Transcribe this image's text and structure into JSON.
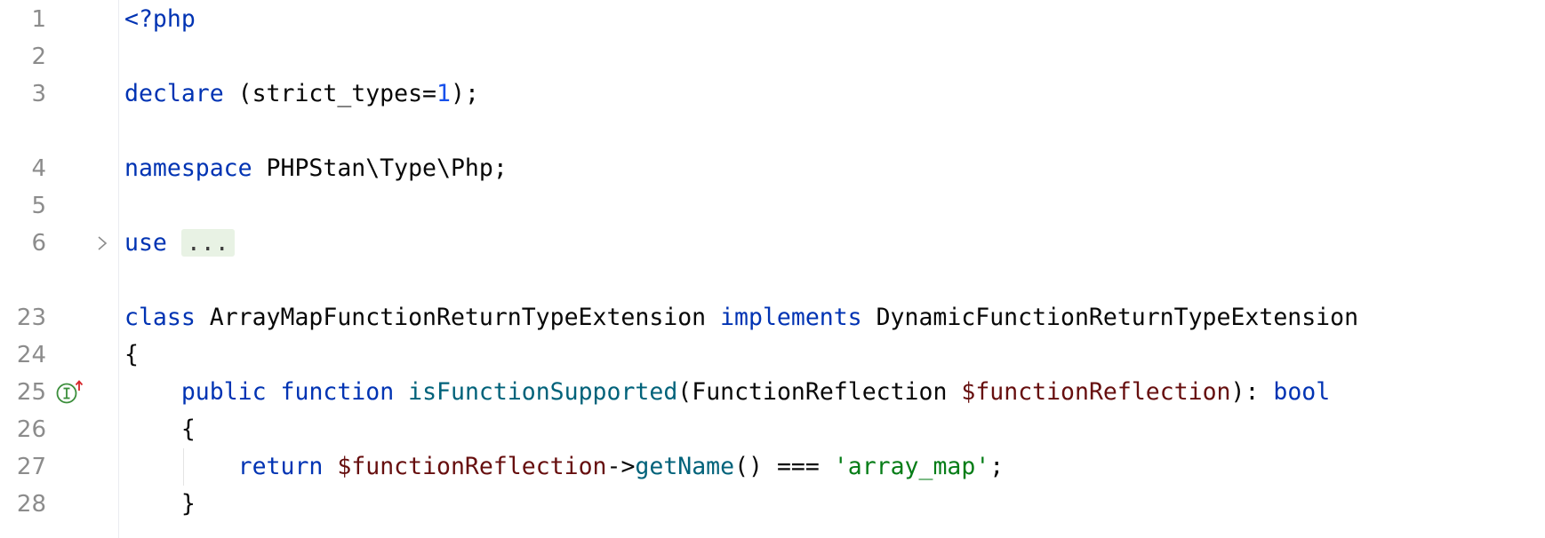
{
  "editor": {
    "language": "php",
    "colors": {
      "keyword": "#0033b3",
      "number": "#1750eb",
      "variable": "#660e0e",
      "function": "#00627a",
      "string": "#067d17",
      "line_number": "#8c8c8c",
      "folded_bg": "#e8f2e4"
    },
    "icons": {
      "fold": "chevron-right-icon",
      "implementing_method": "implementing-method-icon"
    },
    "lines": [
      {
        "number": "1",
        "code": [
          {
            "t": "<?php",
            "c": "kw"
          }
        ]
      },
      {
        "number": "2",
        "code": []
      },
      {
        "number": "3",
        "code": [
          {
            "t": "declare",
            "c": "kw"
          },
          {
            "t": " (strict_types=",
            "c": ""
          },
          {
            "t": "1",
            "c": "num"
          },
          {
            "t": ");",
            "c": ""
          }
        ]
      },
      {
        "number": "4",
        "code": [
          {
            "t": "namespace",
            "c": "kw"
          },
          {
            "t": " PHPStan\\Type\\Php;",
            "c": ""
          }
        ]
      },
      {
        "number": "5",
        "code": []
      },
      {
        "number": "6",
        "code": [
          {
            "t": "use",
            "c": "kw"
          },
          {
            "t": " ",
            "c": ""
          },
          {
            "t": "...",
            "c": "folded"
          }
        ]
      },
      {
        "number": "23",
        "code": [
          {
            "t": "class",
            "c": "kw"
          },
          {
            "t": " ArrayMapFunctionReturnTypeExtension ",
            "c": ""
          },
          {
            "t": "implements",
            "c": "kw"
          },
          {
            "t": " DynamicFunctionReturnTypeExtension",
            "c": ""
          }
        ]
      },
      {
        "number": "24",
        "code": [
          {
            "t": "{",
            "c": ""
          }
        ]
      },
      {
        "number": "25",
        "code": [
          {
            "t": "    ",
            "c": ""
          },
          {
            "t": "public",
            "c": "kw"
          },
          {
            "t": " ",
            "c": ""
          },
          {
            "t": "function",
            "c": "kw"
          },
          {
            "t": " ",
            "c": ""
          },
          {
            "t": "isFunctionSupported",
            "c": "fn"
          },
          {
            "t": "(FunctionReflection ",
            "c": ""
          },
          {
            "t": "$functionReflection",
            "c": "var"
          },
          {
            "t": "): ",
            "c": ""
          },
          {
            "t": "bool",
            "c": "kw"
          }
        ]
      },
      {
        "number": "26",
        "code": [
          {
            "t": "    {",
            "c": ""
          }
        ]
      },
      {
        "number": "27",
        "code": [
          {
            "t": "        ",
            "c": ""
          },
          {
            "t": "return",
            "c": "kw"
          },
          {
            "t": " ",
            "c": ""
          },
          {
            "t": "$functionReflection",
            "c": "var"
          },
          {
            "t": "->",
            "c": ""
          },
          {
            "t": "getName",
            "c": "fn"
          },
          {
            "t": "() === ",
            "c": ""
          },
          {
            "t": "'array_map'",
            "c": "str"
          },
          {
            "t": ";",
            "c": ""
          }
        ]
      },
      {
        "number": "28",
        "code": [
          {
            "t": "    }",
            "c": ""
          }
        ]
      }
    ]
  }
}
